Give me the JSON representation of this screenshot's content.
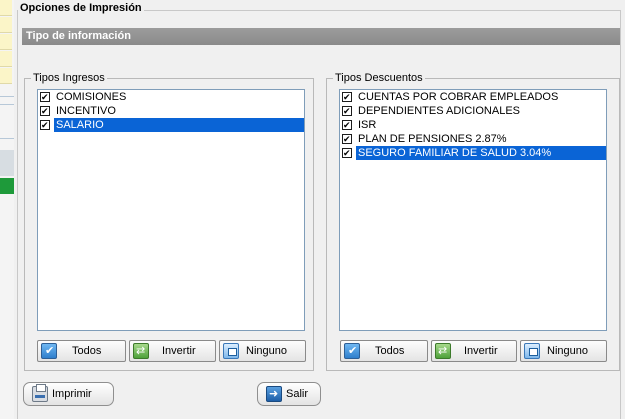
{
  "dialog": {
    "title": "Opciones de Impresión",
    "section_header": "Tipo de información"
  },
  "ingresos": {
    "legend": "Tipos Ingresos",
    "items": [
      {
        "label": "COMISIONES",
        "checked": true,
        "selected": false
      },
      {
        "label": "INCENTIVO",
        "checked": true,
        "selected": false
      },
      {
        "label": "SALARIO",
        "checked": true,
        "selected": true
      }
    ],
    "buttons": {
      "all": "Todos",
      "invert": "Invertir",
      "none": "Ninguno"
    }
  },
  "descuentos": {
    "legend": "Tipos Descuentos",
    "items": [
      {
        "label": "CUENTAS POR COBRAR EMPLEADOS",
        "checked": true,
        "selected": false
      },
      {
        "label": "DEPENDIENTES ADICIONALES",
        "checked": true,
        "selected": false
      },
      {
        "label": "ISR",
        "checked": true,
        "selected": false
      },
      {
        "label": "PLAN DE PENSIONES 2.87%",
        "checked": true,
        "selected": false
      },
      {
        "label": "SEGURO FAMILIAR DE SALUD 3.04%",
        "checked": true,
        "selected": true
      }
    ],
    "buttons": {
      "all": "Todos",
      "invert": "Invertir",
      "none": "Ninguno"
    }
  },
  "footer": {
    "print_label": "Imprimir",
    "exit_label": "Salir"
  },
  "colors": {
    "selection": "#0a64d6",
    "header_bg": "#8a8a8a"
  },
  "icons": {
    "todos": "check-all-icon",
    "invertir": "invert-selection-icon",
    "ninguno": "clear-selection-icon",
    "print": "printer-icon",
    "exit": "exit-door-icon"
  }
}
